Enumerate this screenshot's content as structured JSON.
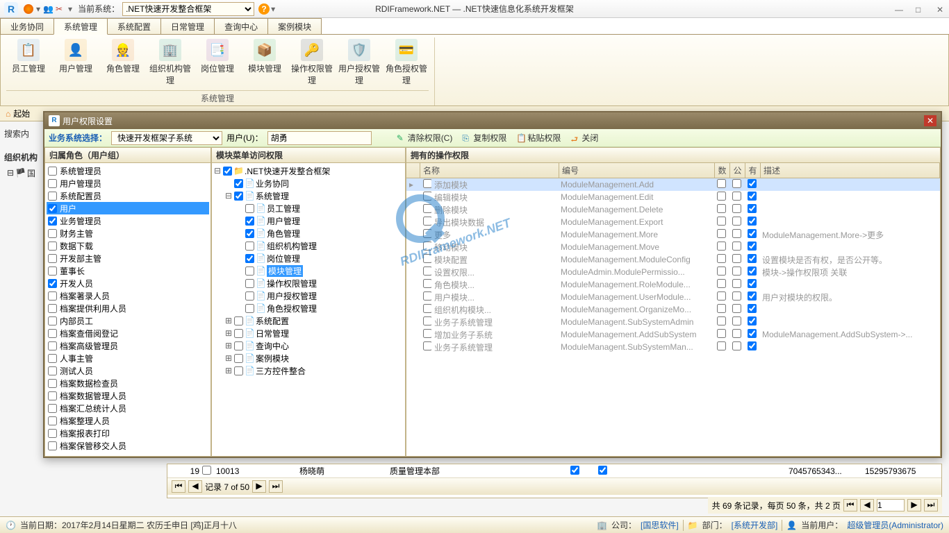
{
  "titlebar": {
    "current_system_label": "当前系统：",
    "current_system_value": ".NET快速开发整合框架",
    "app_title": "RDIFramework.NET — .NET快速信息化系统开发框架"
  },
  "main_tabs": [
    "业务协同",
    "系统管理",
    "系统配置",
    "日常管理",
    "查询中心",
    "案例模块"
  ],
  "ribbon": {
    "items": [
      {
        "label": "员工管理",
        "icon": "📋",
        "color": "#4a90d9"
      },
      {
        "label": "用户管理",
        "icon": "👤",
        "color": "#f39c12"
      },
      {
        "label": "角色管理",
        "icon": "👷",
        "color": "#e67e22"
      },
      {
        "label": "组织机构管理",
        "icon": "🏢",
        "color": "#16a085"
      },
      {
        "label": "岗位管理",
        "icon": "📑",
        "color": "#8e44ad"
      },
      {
        "label": "模块管理",
        "icon": "📦",
        "color": "#27ae60"
      },
      {
        "label": "操作权限管理",
        "icon": "🔑",
        "color": "#2c3e50"
      },
      {
        "label": "用户授权管理",
        "icon": "🛡️",
        "color": "#2980b9"
      },
      {
        "label": "角色授权管理",
        "icon": "💳",
        "color": "#16a085"
      }
    ],
    "group_label": "系统管理"
  },
  "start_tab": "起始",
  "search_label": "搜索内",
  "org_label": "组织机构",
  "left_tree_root": "国",
  "dialog": {
    "title": "用户权限设置",
    "toolbar": {
      "system_label": "业务系统选择：",
      "system_value": "快速开发框架子系统",
      "user_label": "用户(U)：",
      "user_value": "胡勇",
      "clear": "清除权限(C)",
      "copy": "复制权限",
      "paste": "粘贴权限",
      "close": "关闭"
    },
    "panels": {
      "roles": {
        "title": "归属角色（用户组）",
        "items": [
          {
            "label": "系统管理员",
            "checked": false
          },
          {
            "label": "用户管理员",
            "checked": false
          },
          {
            "label": "系统配置员",
            "checked": false
          },
          {
            "label": "用户",
            "checked": true,
            "selected": true
          },
          {
            "label": "业务管理员",
            "checked": true
          },
          {
            "label": "财务主管",
            "checked": false
          },
          {
            "label": "数据下载",
            "checked": false
          },
          {
            "label": "开发部主管",
            "checked": false
          },
          {
            "label": "董事长",
            "checked": false
          },
          {
            "label": "开发人员",
            "checked": true
          },
          {
            "label": "档案著录人员",
            "checked": false
          },
          {
            "label": "档案提供利用人员",
            "checked": false
          },
          {
            "label": "内部员工",
            "checked": false
          },
          {
            "label": "档案查借阅登记",
            "checked": false
          },
          {
            "label": "档案高级管理员",
            "checked": false
          },
          {
            "label": "人事主管",
            "checked": false
          },
          {
            "label": "测试人员",
            "checked": false
          },
          {
            "label": "档案数据检查员",
            "checked": false
          },
          {
            "label": "档案数据管理人员",
            "checked": false
          },
          {
            "label": "档案汇总统计人员",
            "checked": false
          },
          {
            "label": "档案整理人员",
            "checked": false
          },
          {
            "label": "档案报表打印",
            "checked": false
          },
          {
            "label": "档案保管移交人员",
            "checked": false
          }
        ]
      },
      "modules": {
        "title": "模块菜单访问权限",
        "tree": [
          {
            "label": ".NET快速开发整合框架",
            "level": 0,
            "exp": "-",
            "checked": true,
            "icon": "folder"
          },
          {
            "label": "业务协同",
            "level": 1,
            "exp": " ",
            "checked": true,
            "icon": "doc"
          },
          {
            "label": "系统管理",
            "level": 1,
            "exp": "-",
            "checked": true,
            "icon": "doc"
          },
          {
            "label": "员工管理",
            "level": 2,
            "exp": " ",
            "checked": false,
            "icon": "doc"
          },
          {
            "label": "用户管理",
            "level": 2,
            "exp": " ",
            "checked": true,
            "icon": "doc"
          },
          {
            "label": "角色管理",
            "level": 2,
            "exp": " ",
            "checked": true,
            "icon": "doc"
          },
          {
            "label": "组织机构管理",
            "level": 2,
            "exp": " ",
            "checked": false,
            "icon": "doc"
          },
          {
            "label": "岗位管理",
            "level": 2,
            "exp": " ",
            "checked": true,
            "icon": "doc"
          },
          {
            "label": "模块管理",
            "level": 2,
            "exp": " ",
            "checked": false,
            "icon": "doc",
            "selected": true
          },
          {
            "label": "操作权限管理",
            "level": 2,
            "exp": " ",
            "checked": false,
            "icon": "doc"
          },
          {
            "label": "用户授权管理",
            "level": 2,
            "exp": " ",
            "checked": false,
            "icon": "doc"
          },
          {
            "label": "角色授权管理",
            "level": 2,
            "exp": " ",
            "checked": false,
            "icon": "doc"
          },
          {
            "label": "系统配置",
            "level": 1,
            "exp": "+",
            "checked": false,
            "icon": "doc"
          },
          {
            "label": "日常管理",
            "level": 1,
            "exp": "+",
            "checked": false,
            "icon": "doc"
          },
          {
            "label": "查询中心",
            "level": 1,
            "exp": "+",
            "checked": false,
            "icon": "doc"
          },
          {
            "label": "案例模块",
            "level": 1,
            "exp": "+",
            "checked": false,
            "icon": "doc"
          },
          {
            "label": "三方控件整合",
            "level": 1,
            "exp": "+",
            "checked": false,
            "icon": "doc"
          }
        ]
      },
      "permissions": {
        "title": "拥有的操作权限",
        "columns": {
          "name": "名称",
          "code": "编号",
          "c1": "数",
          "c2": "公",
          "c3": "有",
          "desc": "描述"
        },
        "rows": [
          {
            "name": "添加模块",
            "code": "ModuleManagement.Add",
            "c3": true,
            "desc": "",
            "selected": true
          },
          {
            "name": "编辑模块",
            "code": "ModuleManagement.Edit",
            "c3": true,
            "desc": ""
          },
          {
            "name": "删除模块",
            "code": "ModuleManagement.Delete",
            "c3": true,
            "desc": ""
          },
          {
            "name": "导出模块数据",
            "code": "ModuleManagement.Export",
            "c3": true,
            "desc": ""
          },
          {
            "name": "更多",
            "code": "ModuleManagement.More",
            "c3": true,
            "desc": "ModuleManagement.More->更多"
          },
          {
            "name": "移动模块",
            "code": "ModuleManagement.Move",
            "c3": true,
            "desc": ""
          },
          {
            "name": "模块配置",
            "code": "ModuleManagement.ModuleConfig",
            "c3": true,
            "desc": "设置模块是否有权，是否公开等。"
          },
          {
            "name": "设置权限...",
            "code": "ModuleAdmin.ModulePermissio...",
            "c3": true,
            "desc": "模块->操作权限项 关联"
          },
          {
            "name": "角色模块...",
            "code": "ModuleManagement.RoleModule...",
            "c3": true,
            "desc": ""
          },
          {
            "name": "用户模块...",
            "code": "ModuleManagement.UserModule...",
            "c3": true,
            "desc": "用户对模块的权限。"
          },
          {
            "name": "组织机构模块...",
            "code": "ModuleManagement.OrganizeMo...",
            "c3": true,
            "desc": ""
          },
          {
            "name": "业务子系统管理",
            "code": "ModuleManagent.SubSystemAdmin",
            "c3": true,
            "desc": ""
          },
          {
            "name": "增加业务子系统",
            "code": "ModuleManagement.AddSubSystem",
            "c3": true,
            "desc": "ModuleManagement.AddSubSystem->..."
          },
          {
            "name": "业务子系统管理",
            "code": "ModuleManagent.SubSystemMan...",
            "c3": true,
            "desc": ""
          }
        ]
      }
    }
  },
  "lowgrid": {
    "row": {
      "seq": "19",
      "id": "10013",
      "name": "杨晓萌",
      "dept": "质量管理本部",
      "phone1": "7045765343...",
      "phone2": "15295793675"
    },
    "nav": "记录 7 of 50"
  },
  "pager": {
    "text": "共 69 条记录，每页 50 条，共 2 页",
    "page": "1"
  },
  "statusbar": {
    "date": "当前日期：2017年2月14日星期二 农历壬申日 [鸡]正月十八",
    "company_label": "公司：",
    "company": "[国思软件]",
    "dept_label": "部门：",
    "dept": "[系统开发部]",
    "user_label": "当前用户：",
    "user": "超级管理员(Administrator)"
  },
  "watermark": {
    "text": "RDIFramework.NET",
    "url": "http://www.rdiframework.net/"
  }
}
